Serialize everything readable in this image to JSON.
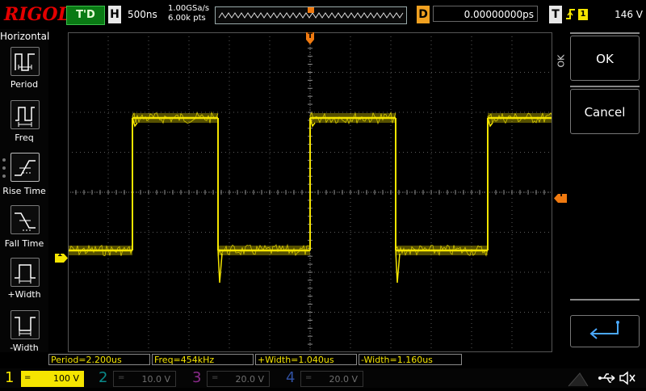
{
  "header": {
    "logo": "RIGOL",
    "status": "T'D",
    "horizontal_label": "H",
    "timebase": "500ns",
    "sample_rate": "1.00GSa/s",
    "memory_depth": "6.00k pts",
    "delay_label": "D",
    "delay_value": "0.00000000ps",
    "trigger_label": "T",
    "trigger_source": "1",
    "trigger_level": "146 V"
  },
  "left_menu": {
    "title": "Horizontal",
    "items": [
      {
        "label": "Period",
        "icon": "period-icon"
      },
      {
        "label": "Freq",
        "icon": "freq-icon"
      },
      {
        "label": "Rise Time",
        "icon": "rise-time-icon"
      },
      {
        "label": "Fall Time",
        "icon": "fall-time-icon"
      },
      {
        "label": "+Width",
        "icon": "positive-width-icon"
      },
      {
        "label": "-Width",
        "icon": "negative-width-icon"
      }
    ]
  },
  "right_menu": {
    "side_label": "OK",
    "ok_label": "OK",
    "cancel_label": "Cancel",
    "enter_icon": "enter-icon"
  },
  "markers": {
    "trigger_position": "T",
    "trigger_level": "T",
    "channel_ground": "1"
  },
  "measurements": {
    "period": "Period=2.200us",
    "freq": "Freq=454kHz",
    "pwidth": "+Width=1.040us",
    "nwidth": "-Width=1.160us"
  },
  "channels": [
    {
      "num": "1",
      "scale": "100 V",
      "color": "#f5e500",
      "active": true
    },
    {
      "num": "2",
      "scale": "10.0 V",
      "color": "#00c0c0",
      "active": false
    },
    {
      "num": "3",
      "scale": "20.0 V",
      "color": "#e040e0",
      "active": false
    },
    {
      "num": "4",
      "scale": "20.0 V",
      "color": "#3060ff",
      "active": false
    }
  ],
  "colors": {
    "ch1": "#f5e500",
    "grid": "#5a5a5a",
    "logo": "#e40000",
    "delay": "#f0a020"
  }
}
